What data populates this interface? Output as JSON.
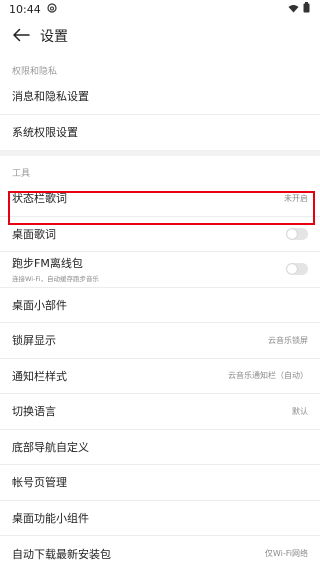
{
  "status": {
    "time": "10:44"
  },
  "header": {
    "title": "设置"
  },
  "sections": [
    {
      "label": "权限和隐私",
      "rows": [
        {
          "label": "消息和隐私设置"
        },
        {
          "label": "系统权限设置"
        }
      ]
    },
    {
      "label": "工具",
      "rows": [
        {
          "label": "状态栏歌词",
          "value": "未开启"
        },
        {
          "label": "桌面歌词",
          "toggle": "off"
        },
        {
          "label": "跑步FM离线包",
          "sub": "连接Wi-Fi，自动缓存跑步音乐",
          "toggle": "off"
        },
        {
          "label": "桌面小部件"
        },
        {
          "label": "锁屏显示",
          "value": "云音乐锁屏"
        },
        {
          "label": "通知栏样式",
          "value": "云音乐通知栏（自动）"
        },
        {
          "label": "切换语言",
          "value": "默认"
        },
        {
          "label": "底部导航自定义"
        },
        {
          "label": "帐号页管理"
        },
        {
          "label": "桌面功能小组件"
        },
        {
          "label": "自动下载最新安装包",
          "value": "仅Wi-Fi网络"
        }
      ]
    }
  ],
  "colors": {
    "highlight": "#e60012",
    "divider": "#f2f2f2"
  },
  "icons": [
    "netease-music-icon",
    "wifi-icon",
    "battery-icon",
    "back-arrow-icon"
  ]
}
